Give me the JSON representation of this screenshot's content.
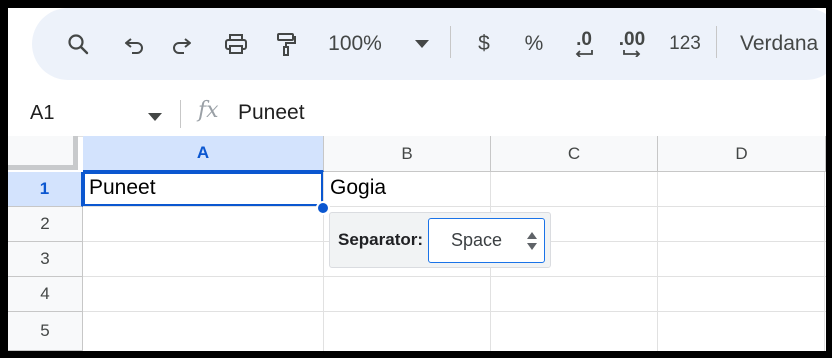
{
  "toolbar": {
    "zoom": "100%",
    "currency": "$",
    "percent": "%",
    "decrease_decimal": ".0",
    "increase_decimal": ".00",
    "number_format": "123",
    "font": "Verdana"
  },
  "formula_bar": {
    "name_box": "A1",
    "fx": "fx",
    "value": "Puneet"
  },
  "grid": {
    "columns": [
      "A",
      "B",
      "C",
      "D"
    ],
    "rows": [
      "1",
      "2",
      "3",
      "4",
      "5"
    ],
    "cells": {
      "A1": "Puneet",
      "B1": "Gogia"
    }
  },
  "popup": {
    "label": "Separator:",
    "value": "Space"
  },
  "colors": {
    "accent": "#0b57d0",
    "toolbar_bg": "#edf2fa",
    "header_selected": "#d3e3fd"
  }
}
